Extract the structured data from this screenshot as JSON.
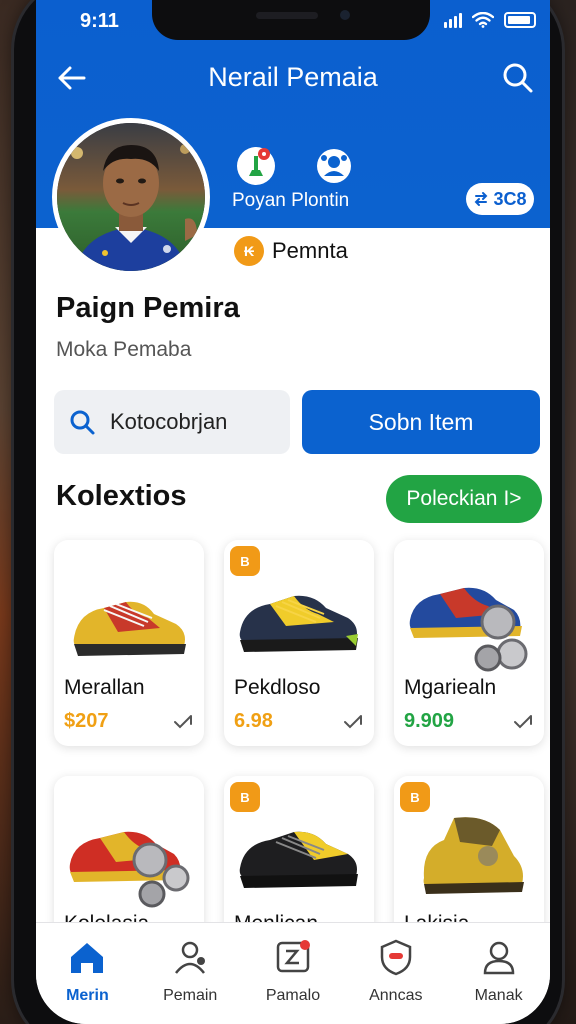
{
  "status": {
    "time": "9:11"
  },
  "header": {
    "title": "Nerail Pemaia"
  },
  "quick_actions": {
    "label": "Poyan Plontin",
    "chip": "3C8"
  },
  "rank": {
    "label": "Pemnta"
  },
  "profile": {
    "name": "Paign Pemira",
    "subtitle": "Moka Pemaba"
  },
  "search": {
    "text": "Kotocobrjan"
  },
  "primary_button": {
    "label": "Sobn Item"
  },
  "collection": {
    "title": "Kolextios",
    "more_label": "Poleckian"
  },
  "items": [
    {
      "name": "Merallan",
      "price": "$207",
      "price_color": "#f0a014",
      "icon": "sneaker-yellow-red",
      "badge": false
    },
    {
      "name": "Pekdloso",
      "price": "6.98",
      "price_color": "#f0a014",
      "icon": "sneaker-navy-yellow",
      "badge": true,
      "badge_text": "B"
    },
    {
      "name": "Mgariealn",
      "price": "9.909",
      "price_color": "#22a444",
      "icon": "sneaker-blue-coins",
      "badge": false
    },
    {
      "name": "Kolelasia",
      "price": "",
      "icon": "sneaker-red-coins",
      "badge": false
    },
    {
      "name": "Menlican",
      "price": "",
      "icon": "sneaker-black-yellow",
      "badge": true,
      "badge_text": "B"
    },
    {
      "name": "Lakisia",
      "price": "",
      "icon": "sneaker-yellow-boot",
      "badge": true,
      "badge_text": "B"
    }
  ],
  "tabs": [
    {
      "label": "Merin",
      "icon": "home-icon",
      "active": true
    },
    {
      "label": "Pemain",
      "icon": "people-icon",
      "active": false
    },
    {
      "label": "Pamalo",
      "icon": "wallet-icon",
      "active": false
    },
    {
      "label": "Anncas",
      "icon": "shield-icon",
      "active": false
    },
    {
      "label": "Manak",
      "icon": "user-icon",
      "active": false
    }
  ],
  "colors": {
    "brand_blue": "#0b62cf",
    "accent_green": "#22a444",
    "accent_orange": "#f19a17"
  }
}
